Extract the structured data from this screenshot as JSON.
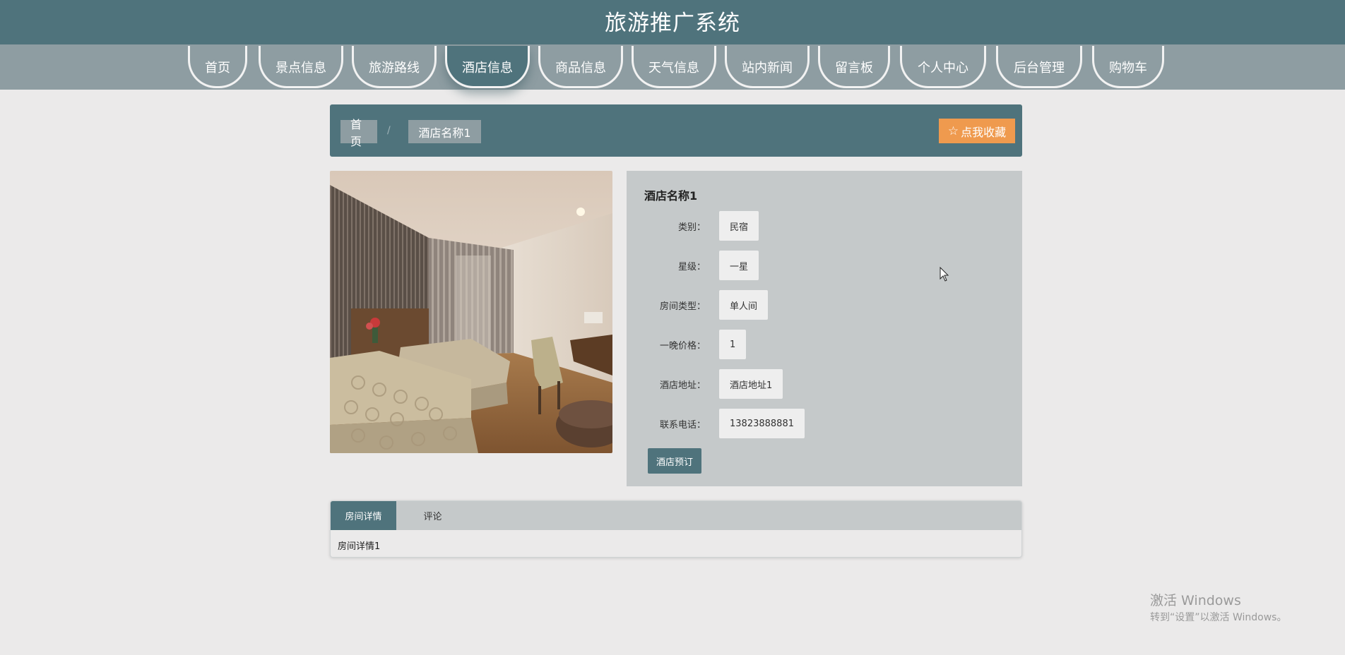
{
  "header": {
    "title": "旅游推广系统"
  },
  "nav": {
    "items": [
      {
        "label": "首页"
      },
      {
        "label": "景点信息"
      },
      {
        "label": "旅游路线"
      },
      {
        "label": "酒店信息",
        "active": true
      },
      {
        "label": "商品信息"
      },
      {
        "label": "天气信息"
      },
      {
        "label": "站内新闻"
      },
      {
        "label": "留言板"
      },
      {
        "label": "个人中心"
      },
      {
        "label": "后台管理"
      },
      {
        "label": "购物车"
      }
    ]
  },
  "breadcrumb": {
    "home": "首页",
    "separator": "/",
    "current": "酒店名称1"
  },
  "favorite_button": {
    "label": "点我收藏",
    "icon": "star-outline-icon",
    "color": "#ef9a4e"
  },
  "hotel": {
    "name": "酒店名称1",
    "fields": [
      {
        "label": "类别：",
        "value": "民宿"
      },
      {
        "label": "星级：",
        "value": "一星"
      },
      {
        "label": "房间类型：",
        "value": "单人间"
      },
      {
        "label": "一晚价格：",
        "value": "1"
      },
      {
        "label": "酒店地址：",
        "value": "酒店地址1"
      },
      {
        "label": "联系电话：",
        "value": "13823888881"
      }
    ],
    "book_button": "酒店预订"
  },
  "tabs": {
    "items": [
      {
        "label": "房间详情",
        "active": true
      },
      {
        "label": "评论"
      }
    ],
    "content": "房间详情1"
  },
  "watermark": {
    "title": "激活 Windows",
    "subtitle": "转到“设置”以激活 Windows。"
  },
  "colors": {
    "primary": "#4f737c",
    "nav_bg": "#8e9da2",
    "panel_bg": "#c5c9ca",
    "page_bg": "#ebeaea"
  }
}
